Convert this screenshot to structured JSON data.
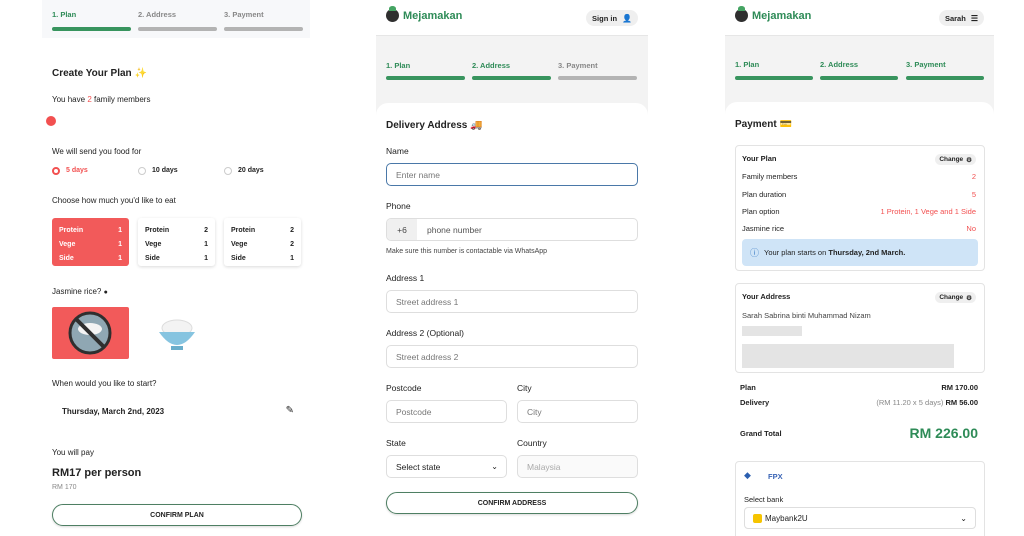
{
  "plan_screen": {
    "steps": [
      "1. Plan",
      "2. Address",
      "3. Payment"
    ],
    "title": "Create Your Plan",
    "title_emoji": "✨",
    "members_prefix": "You have",
    "members_count": "2",
    "members_suffix": "family members",
    "food_for_label": "We will send you food for",
    "duration_options": [
      "5 days",
      "10 days",
      "20 days"
    ],
    "selected_duration": "5 days",
    "eat_label": "Choose how much you'd like to eat",
    "portion_options": [
      {
        "rows": [
          [
            "Protein",
            "1"
          ],
          [
            "Vege",
            "1"
          ],
          [
            "Side",
            "1"
          ]
        ],
        "selected": true
      },
      {
        "rows": [
          [
            "Protein",
            "2"
          ],
          [
            "Vege",
            "1"
          ],
          [
            "Side",
            "1"
          ]
        ],
        "selected": false
      },
      {
        "rows": [
          [
            "Protein",
            "2"
          ],
          [
            "Vege",
            "2"
          ],
          [
            "Side",
            "1"
          ]
        ],
        "selected": false
      }
    ],
    "rice_label": "Jasmine rice?",
    "start_label": "When would you like to start?",
    "start_date": "Thursday, March 2nd, 2023",
    "pay_label": "You will pay",
    "price": "RM17 per person",
    "price_sub": "RM 170",
    "confirm_button": "CONFIRM PLAN"
  },
  "address_screen": {
    "brand": "Mejamakan",
    "sign_in": "Sign in",
    "steps": [
      "1. Plan",
      "2. Address",
      "3. Payment"
    ],
    "title": "Delivery Address",
    "title_emoji": "🚚",
    "name_label": "Name",
    "name_placeholder": "Enter name",
    "phone_label": "Phone",
    "phone_prefix": "+6",
    "phone_placeholder": "phone number",
    "phone_hint": "Make sure this number is contactable via WhatsApp",
    "address1_label": "Address 1",
    "address1_placeholder": "Street address 1",
    "address2_label": "Address 2 (Optional)",
    "address2_placeholder": "Street address 2",
    "postcode_label": "Postcode",
    "postcode_placeholder": "Postcode",
    "city_label": "City",
    "city_placeholder": "City",
    "state_label": "State",
    "state_value": "Select state",
    "country_label": "Country",
    "country_value": "Malaysia",
    "confirm_button": "CONFIRM ADDRESS"
  },
  "payment_screen": {
    "brand": "Mejamakan",
    "user": "Sarah",
    "steps": [
      "1. Plan",
      "2. Address",
      "3. Payment"
    ],
    "title": "Payment",
    "title_emoji": "💳",
    "plan_card": {
      "title": "Your Plan",
      "change": "Change",
      "rows": [
        [
          "Family members",
          "2"
        ],
        [
          "Plan duration",
          "5"
        ],
        [
          "Plan option",
          "1 Protein, 1 Vege and 1 Side"
        ],
        [
          "Jasmine rice",
          "No"
        ]
      ],
      "notice_prefix": "Your plan starts on",
      "notice_date": "Thursday, 2nd March."
    },
    "address_card": {
      "title": "Your Address",
      "change": "Change",
      "name": "Sarah Sabrina binti Muhammad Nizam"
    },
    "totals": {
      "plan_label": "Plan",
      "plan_value": "RM 170.00",
      "delivery_label": "Delivery",
      "delivery_note": "(RM 11.20 x 5 days)",
      "delivery_value": "RM 56.00",
      "grand_label": "Grand Total",
      "grand_value": "RM 226.00"
    },
    "fpx": {
      "label": "FPX",
      "select_bank_label": "Select bank",
      "bank": "Maybank2U"
    }
  },
  "colors": {
    "brand_green": "#2e8b57",
    "accent_red": "#f25050",
    "info_blue": "#cfe4f7"
  }
}
